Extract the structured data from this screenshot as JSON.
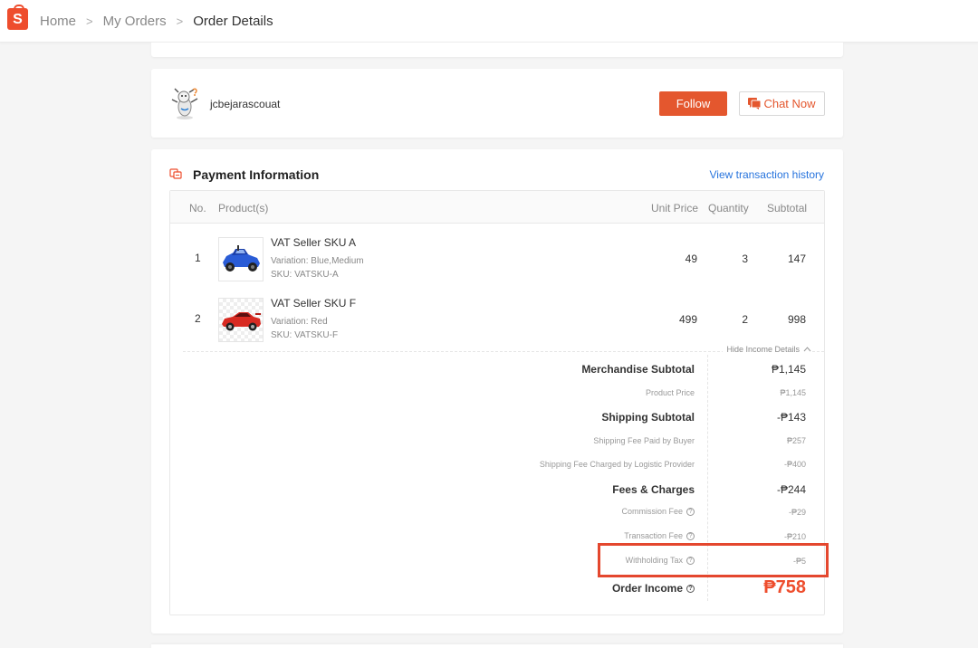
{
  "breadcrumb": {
    "home": "Home",
    "my_orders": "My Orders",
    "current": "Order Details"
  },
  "seller": {
    "name": "jcbejarascouat",
    "follow_label": "Follow",
    "chat_label": "Chat Now"
  },
  "payment": {
    "title": "Payment Information",
    "history_link": "View transaction history",
    "columns": {
      "no": "No.",
      "product": "Product(s)",
      "unit_price": "Unit Price",
      "quantity": "Quantity",
      "subtotal": "Subtotal"
    },
    "items": [
      {
        "no": "1",
        "name": "VAT Seller SKU A",
        "variation": "Variation: Blue,Medium",
        "sku": "SKU: VATSKU-A",
        "unit_price": "49",
        "quantity": "3",
        "subtotal": "147"
      },
      {
        "no": "2",
        "name": "VAT Seller SKU F",
        "variation": "Variation: Red",
        "sku": "SKU: VATSKU-F",
        "unit_price": "499",
        "quantity": "2",
        "subtotal": "998"
      }
    ],
    "hide_details": "Hide Income Details",
    "income": {
      "merch_subtotal_label": "Merchandise Subtotal",
      "merch_subtotal_value": "₱1,145",
      "product_price_label": "Product Price",
      "product_price_value": "₱1,145",
      "shipping_subtotal_label": "Shipping Subtotal",
      "shipping_subtotal_value": "-₱143",
      "ship_paid_label": "Shipping Fee Paid by Buyer",
      "ship_paid_value": "₱257",
      "ship_charged_label": "Shipping Fee Charged by Logistic Provider",
      "ship_charged_value": "-₱400",
      "fees_label": "Fees & Charges",
      "fees_value": "-₱244",
      "commission_label": "Commission Fee",
      "commission_value": "-₱29",
      "transaction_label": "Transaction Fee",
      "transaction_value": "-₱210",
      "withholding_label": "Withholding Tax",
      "withholding_value": "-₱5",
      "order_income_label": "Order Income",
      "order_income_value": "₱758"
    }
  },
  "colors": {
    "brand": "#ee4d2d",
    "link": "#2673dd",
    "highlight": "#e4472e"
  }
}
